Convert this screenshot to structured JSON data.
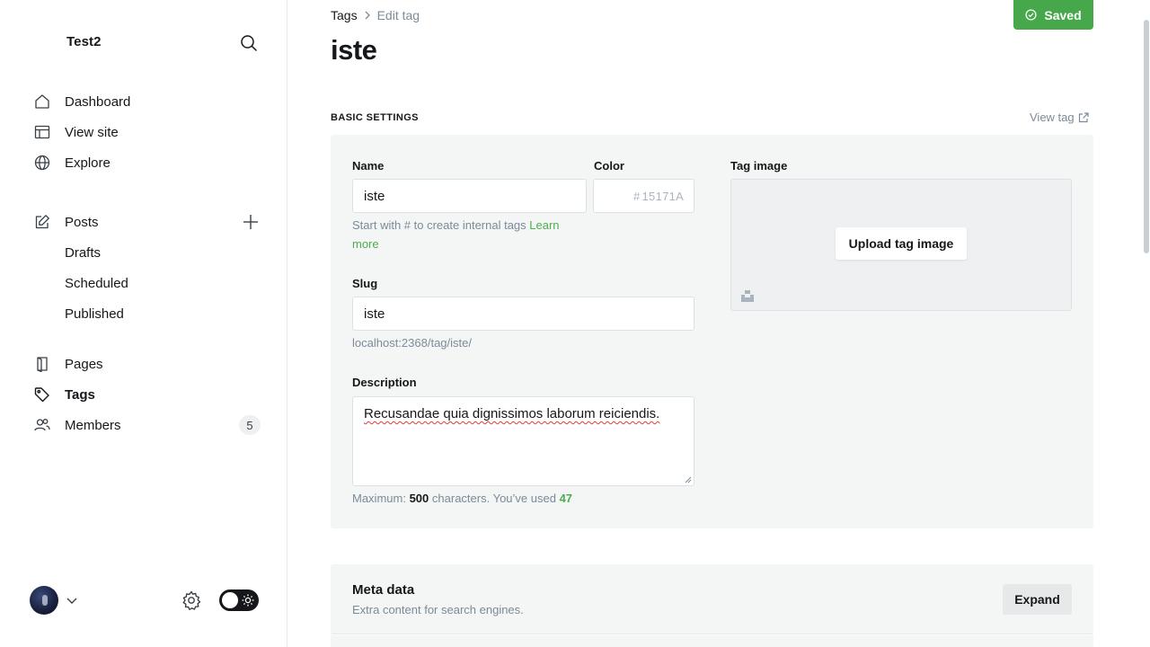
{
  "sidebar": {
    "site_title": "Test2",
    "nav": {
      "dashboard": "Dashboard",
      "view_site": "View site",
      "explore": "Explore",
      "posts": "Posts",
      "drafts": "Drafts",
      "scheduled": "Scheduled",
      "published": "Published",
      "pages": "Pages",
      "tags": "Tags",
      "members": "Members",
      "members_count": "5"
    },
    "active_item": "Tags"
  },
  "header": {
    "breadcrumb_parent": "Tags",
    "breadcrumb_current": "Edit tag",
    "title": "iste",
    "saved_label": "Saved"
  },
  "basic_settings": {
    "section_label": "BASIC SETTINGS",
    "view_tag_label": "View tag",
    "name_label": "Name",
    "name_value": "iste",
    "name_hint": "Start with # to create internal tags",
    "name_hint_link": "Learn more",
    "color_label": "Color",
    "color_hash": "#",
    "color_placeholder": "15171A",
    "slug_label": "Slug",
    "slug_value": "iste",
    "slug_url": "localhost:2368/tag/iste/",
    "description_label": "Description",
    "description_value": "Recusandae quia dignissimos laborum reiciendis.",
    "counter_prefix": "Maximum:",
    "counter_max": "500",
    "counter_mid": "characters. You’ve used",
    "counter_used": "47",
    "tag_image_label": "Tag image",
    "upload_label": "Upload tag image"
  },
  "meta_data": {
    "title": "Meta data",
    "subtitle": "Extra content for search engines.",
    "expand_label": "Expand"
  },
  "colors": {
    "accent_green": "#46a84a",
    "panel_bg": "#f4f5f5",
    "muted_text": "#7c8b9a"
  }
}
